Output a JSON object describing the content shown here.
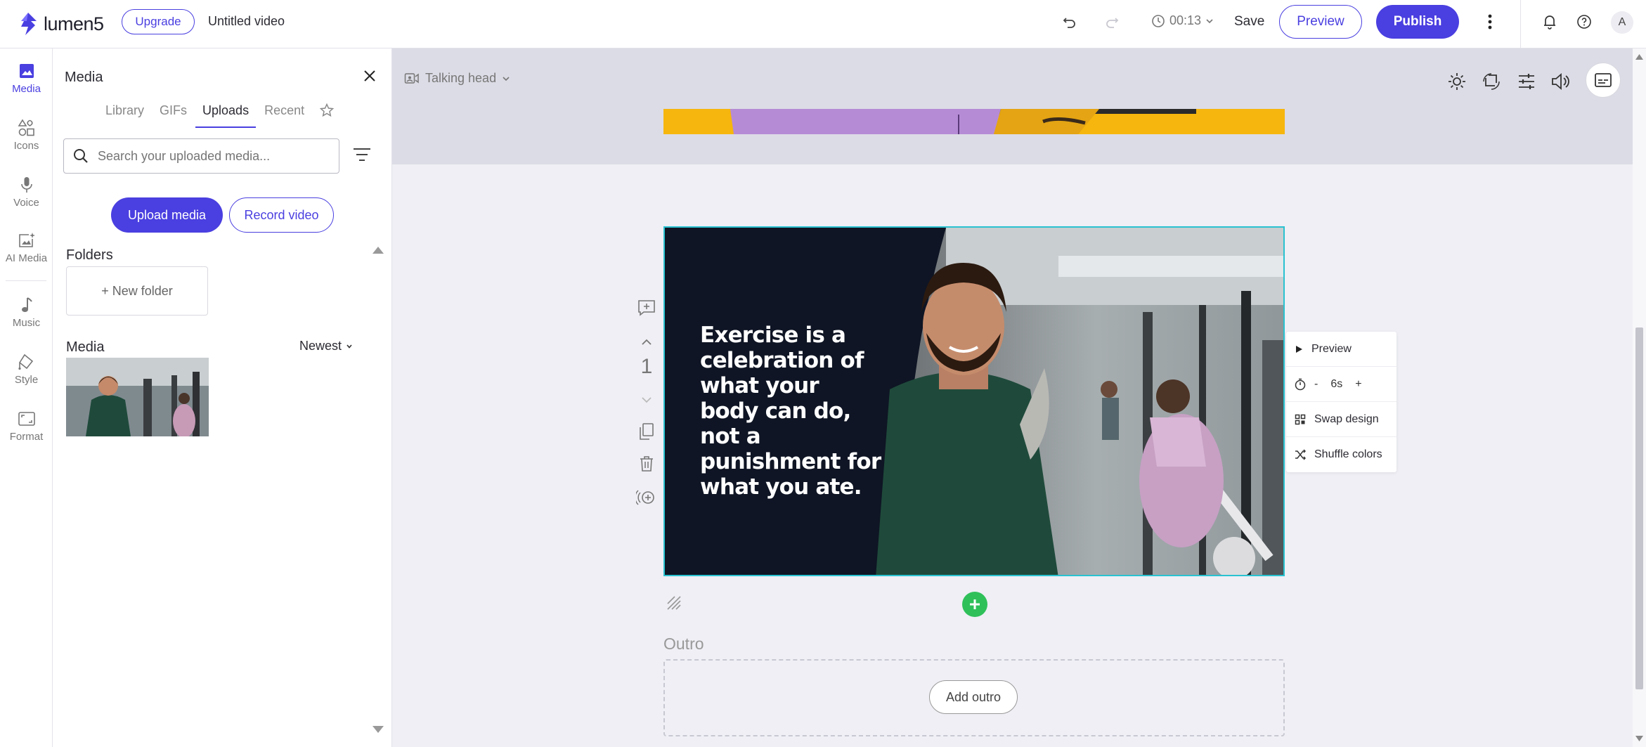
{
  "topbar": {
    "logo_text": "lumen5",
    "upgrade_label": "Upgrade",
    "video_title": "Untitled video",
    "duration": "00:13",
    "save_label": "Save",
    "preview_label": "Preview",
    "publish_label": "Publish",
    "avatar_initial": "A"
  },
  "rail": {
    "items": [
      {
        "label": "Media",
        "icon": "image-icon",
        "active": true
      },
      {
        "label": "Icons",
        "icon": "shapes-icon"
      },
      {
        "label": "Voice",
        "icon": "microphone-icon"
      },
      {
        "label": "AI Media",
        "icon": "ai-image-icon"
      },
      {
        "label": "Music",
        "icon": "music-note-icon"
      },
      {
        "label": "Style",
        "icon": "paint-bucket-icon"
      },
      {
        "label": "Format",
        "icon": "aspect-ratio-icon"
      }
    ]
  },
  "panel": {
    "title": "Media",
    "tabs": [
      {
        "label": "Library"
      },
      {
        "label": "GIFs"
      },
      {
        "label": "Uploads",
        "active": true
      },
      {
        "label": "Recent"
      }
    ],
    "search_placeholder": "Search your uploaded media...",
    "upload_label": "Upload media",
    "record_label": "Record video",
    "folders_label": "Folders",
    "new_folder_label": "+ New folder",
    "media_label": "Media",
    "sort_label": "Newest"
  },
  "workspace": {
    "layout_label": "Talking head",
    "scene_text": "Exercise is a celebration of what your body can do, not a punishment for what you ate.",
    "scene_number": "1",
    "context_menu": {
      "preview_label": "Preview",
      "duration_minus": "-",
      "duration_value": "6s",
      "duration_plus": "+",
      "swap_label": "Swap design",
      "shuffle_label": "Shuffle colors"
    },
    "outro_label": "Outro",
    "add_outro_label": "Add outro"
  },
  "colors": {
    "brand": "#4a3fe0",
    "selected_scene_border": "#29c2d0",
    "add_scene_green": "#2fc05a",
    "scene_background": "#0f1524",
    "previous_scene_bar": "#f6b60d"
  }
}
